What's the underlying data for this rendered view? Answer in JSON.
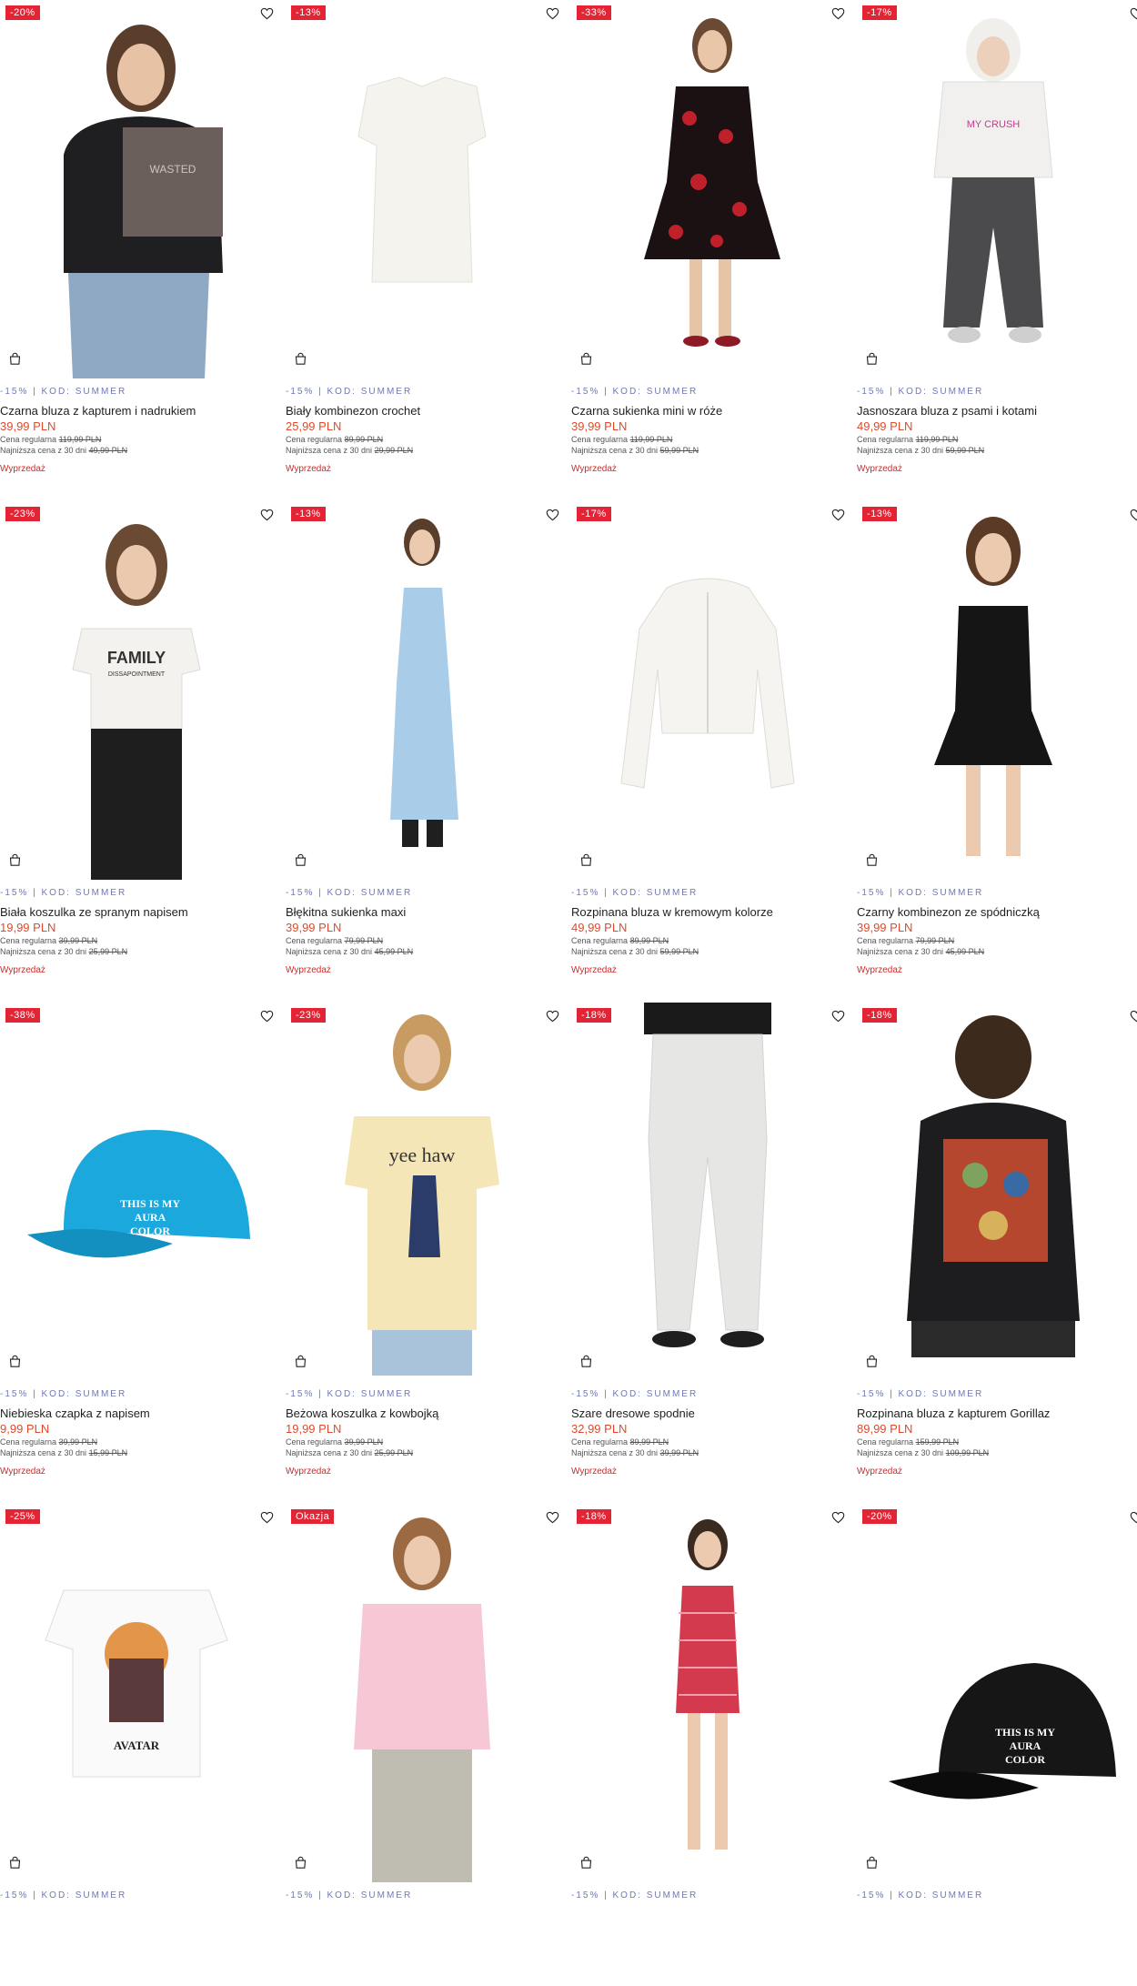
{
  "colors": {
    "badge": "#e32434",
    "price": "#e04a2a",
    "promo": "#6f78b7",
    "sale": "#cc2b2b"
  },
  "icons": {
    "favorite": "heart-outline-icon",
    "cart": "shopping-bag-icon"
  },
  "products": [
    {
      "badge": "-20%",
      "promo": "-15% | KOD: SUMMER",
      "name": "Czarna bluza z kapturem i nadrukiem",
      "price": "39,99 PLN",
      "regular_label": "Cena regularna",
      "regular_price": "119,99 PLN",
      "lowest_label": "Najniższa cena z 30 dni",
      "lowest_price": "49,99 PLN",
      "sale": "Wyprzedaż"
    },
    {
      "badge": "-13%",
      "promo": "-15% | KOD: SUMMER",
      "name": "Biały kombinezon crochet",
      "price": "25,99 PLN",
      "regular_label": "Cena regularna",
      "regular_price": "89,99 PLN",
      "lowest_label": "Najniższa cena z 30 dni",
      "lowest_price": "29,99 PLN",
      "sale": "Wyprzedaż"
    },
    {
      "badge": "-33%",
      "promo": "-15% | KOD: SUMMER",
      "name": "Czarna sukienka mini w róże",
      "price": "39,99 PLN",
      "regular_label": "Cena regularna",
      "regular_price": "119,99 PLN",
      "lowest_label": "Najniższa cena z 30 dni",
      "lowest_price": "59,99 PLN",
      "sale": "Wyprzedaż"
    },
    {
      "badge": "-17%",
      "promo": "-15% | KOD: SUMMER",
      "name": "Jasnoszara bluza z psami i kotami",
      "price": "49,99 PLN",
      "regular_label": "Cena regularna",
      "regular_price": "119,99 PLN",
      "lowest_label": "Najniższa cena z 30 dni",
      "lowest_price": "59,99 PLN",
      "sale": "Wyprzedaż"
    },
    {
      "badge": "-23%",
      "promo": "-15% | KOD: SUMMER",
      "name": "Biała koszulka ze spranym napisem",
      "price": "19,99 PLN",
      "regular_label": "Cena regularna",
      "regular_price": "39,99 PLN",
      "lowest_label": "Najniższa cena z 30 dni",
      "lowest_price": "25,99 PLN",
      "sale": "Wyprzedaż"
    },
    {
      "badge": "-13%",
      "promo": "-15% | KOD: SUMMER",
      "name": "Błękitna sukienka maxi",
      "price": "39,99 PLN",
      "regular_label": "Cena regularna",
      "regular_price": "79,99 PLN",
      "lowest_label": "Najniższa cena z 30 dni",
      "lowest_price": "45,99 PLN",
      "sale": "Wyprzedaż"
    },
    {
      "badge": "-17%",
      "promo": "-15% | KOD: SUMMER",
      "name": "Rozpinana bluza w kremowym kolorze",
      "price": "49,99 PLN",
      "regular_label": "Cena regularna",
      "regular_price": "89,99 PLN",
      "lowest_label": "Najniższa cena z 30 dni",
      "lowest_price": "59,99 PLN",
      "sale": "Wyprzedaż"
    },
    {
      "badge": "-13%",
      "promo": "-15% | KOD: SUMMER",
      "name": "Czarny kombinezon ze spódniczką",
      "price": "39,99 PLN",
      "regular_label": "Cena regularna",
      "regular_price": "79,99 PLN",
      "lowest_label": "Najniższa cena z 30 dni",
      "lowest_price": "45,99 PLN",
      "sale": "Wyprzedaż"
    },
    {
      "badge": "-38%",
      "promo": "-15% | KOD: SUMMER",
      "name": "Niebieska czapka z napisem",
      "price": "9,99 PLN",
      "regular_label": "Cena regularna",
      "regular_price": "39,99 PLN",
      "lowest_label": "Najniższa cena z 30 dni",
      "lowest_price": "15,99 PLN",
      "sale": "Wyprzedaż"
    },
    {
      "badge": "-23%",
      "promo": "-15% | KOD: SUMMER",
      "name": "Beżowa koszulka z kowbojką",
      "price": "19,99 PLN",
      "regular_label": "Cena regularna",
      "regular_price": "39,99 PLN",
      "lowest_label": "Najniższa cena z 30 dni",
      "lowest_price": "25,99 PLN",
      "sale": "Wyprzedaż"
    },
    {
      "badge": "-18%",
      "promo": "-15% | KOD: SUMMER",
      "name": "Szare dresowe spodnie",
      "price": "32,99 PLN",
      "regular_label": "Cena regularna",
      "regular_price": "89,99 PLN",
      "lowest_label": "Najniższa cena z 30 dni",
      "lowest_price": "39,99 PLN",
      "sale": "Wyprzedaż"
    },
    {
      "badge": "-18%",
      "promo": "-15% | KOD: SUMMER",
      "name": "Rozpinana bluza z kapturem Gorillaz",
      "price": "89,99 PLN",
      "regular_label": "Cena regularna",
      "regular_price": "159,99 PLN",
      "lowest_label": "Najniższa cena z 30 dni",
      "lowest_price": "109,99 PLN",
      "sale": "Wyprzedaż"
    },
    {
      "badge": "-25%",
      "promo": "-15% | KOD: SUMMER"
    },
    {
      "badge": "Okazja",
      "promo": "-15% | KOD: SUMMER"
    },
    {
      "badge": "-18%",
      "promo": "-15% | KOD: SUMMER"
    },
    {
      "badge": "-20%",
      "promo": "-15% | KOD: SUMMER"
    }
  ],
  "print_texts": {
    "hoodie": "WASTED",
    "tee": "FAMILY",
    "tee_sub": "DISSAPOINTMENT",
    "cap_blue": "THIS IS MY AURA COLOR",
    "cowgirl": "yee haw",
    "avatar": "AVATAR",
    "cap_black": "THIS IS MY AURA COLOR",
    "crush": "MY CRUSH"
  }
}
